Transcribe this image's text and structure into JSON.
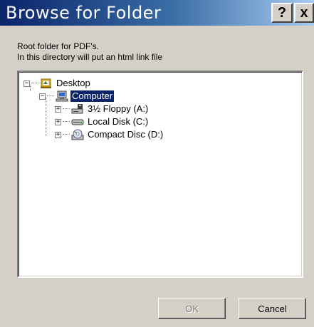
{
  "window": {
    "title": "Browse for Folder",
    "help_label": "?",
    "close_label": "x"
  },
  "description": {
    "line1": "Root folder for PDF's.",
    "line2": "In this directory will put an html link file"
  },
  "tree": {
    "desktop": {
      "label": "Desktop",
      "expander": "−",
      "icon": "desktop-icon"
    },
    "computer": {
      "label": "Computer",
      "expander": "−",
      "icon": "computer-icon",
      "selected": true
    },
    "floppy": {
      "label": "3½ Floppy (A:)",
      "expander": "+",
      "icon": "floppy-drive-icon"
    },
    "local": {
      "label": "Local Disk (C:)",
      "expander": "+",
      "icon": "hard-disk-icon"
    },
    "cd": {
      "label": "Compact Disc (D:)",
      "expander": "+",
      "icon": "cd-drive-icon"
    }
  },
  "buttons": {
    "ok_label": "OK",
    "cancel_label": "Cancel"
  },
  "colors": {
    "title_start": "#0a246a",
    "title_end": "#a6caf0",
    "selection": "#0a246a",
    "dialog_bg": "#d4d0c8"
  }
}
